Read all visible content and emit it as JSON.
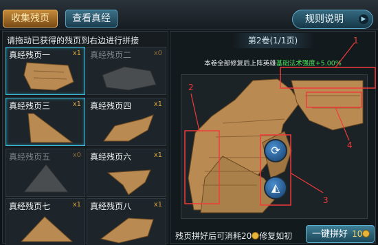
{
  "header": {
    "tab_collect": "收集残页",
    "tab_view": "查看真经",
    "rules_label": "规则说明"
  },
  "left_panel": {
    "hint": "请拖动已获得的残页到右边进行拼接",
    "cards": [
      {
        "name": "真经残页一",
        "count": "x1",
        "state": "selected"
      },
      {
        "name": "真经残页二",
        "count": "x0",
        "state": "dim"
      },
      {
        "name": "真经残页三",
        "count": "x1",
        "state": "selected"
      },
      {
        "name": "真经残页四",
        "count": "x1",
        "state": "normal"
      },
      {
        "name": "真经残页五",
        "count": "x0",
        "state": "dim"
      },
      {
        "name": "真经残页六",
        "count": "x1",
        "state": "normal"
      },
      {
        "name": "真经残页七",
        "count": "x1",
        "state": "normal"
      },
      {
        "name": "真经残页八",
        "count": "x1",
        "state": "normal"
      }
    ]
  },
  "right_panel": {
    "volume_title": "第2卷(1/1页)",
    "bonus_prefix": "本卷全部修复后上阵英雄",
    "bonus_highlight": "基础法术强度+5.00%",
    "rotate_icon": "rotate-icon",
    "flip_icon": "flip-icon"
  },
  "footer": {
    "cost_text_before": "残页拼好后可消耗20",
    "cost_text_after": "修复如初",
    "onekey_label": "一键拼好",
    "onekey_cost": "10"
  },
  "annotations": [
    "1",
    "2",
    "3",
    "4"
  ],
  "colors": {
    "accent_gold": "#d9a440",
    "bonus_green": "#49e05a",
    "annotation_red": "#f03a3a"
  }
}
